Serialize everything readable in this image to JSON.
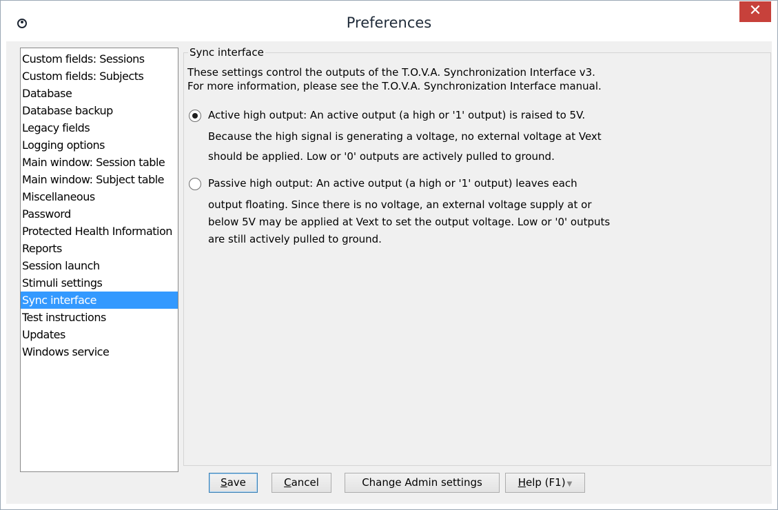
{
  "window": {
    "title": "Preferences",
    "close_glyph": "✕"
  },
  "sidebar": {
    "items": [
      {
        "label": "Custom fields: Sessions"
      },
      {
        "label": "Custom fields: Subjects"
      },
      {
        "label": "Database"
      },
      {
        "label": "Database backup"
      },
      {
        "label": "Legacy fields"
      },
      {
        "label": "Logging options"
      },
      {
        "label": "Main window: Session table"
      },
      {
        "label": "Main window: Subject table"
      },
      {
        "label": "Miscellaneous"
      },
      {
        "label": "Password"
      },
      {
        "label": "Protected Health Information"
      },
      {
        "label": "Reports"
      },
      {
        "label": "Session launch"
      },
      {
        "label": "Stimuli settings"
      },
      {
        "label": "Sync interface",
        "selected": true
      },
      {
        "label": "Test instructions"
      },
      {
        "label": "Updates"
      },
      {
        "label": "Windows service"
      }
    ],
    "selected_color": "#3399ff"
  },
  "panel": {
    "legend": "Sync interface",
    "intro_line1": "These settings control the outputs of the T.O.V.A. Synchronization Interface v3.",
    "intro_line2": "For more information, please see the T.O.V.A. Synchronization Interface manual.",
    "options": [
      {
        "checked": true,
        "lines": [
          "Active high output: An active output (a high or '1' output) is raised to 5V.",
          "Because the high signal is generating a voltage, no external voltage at Vext",
          "should be applied. Low or '0' outputs are actively pulled to ground."
        ]
      },
      {
        "checked": false,
        "lines": [
          "Passive high output: An active output (a high or '1' output) leaves each",
          "output floating. Since there is no voltage, an external voltage supply at or",
          "below 5V may be applied at Vext to set the output voltage. Low or '0' outputs",
          "are still actively pulled to ground."
        ]
      }
    ]
  },
  "buttons": {
    "save_prefix": "S",
    "save_rest": "ave",
    "cancel_prefix": "C",
    "cancel_rest": "ancel",
    "admin_pre": "Chan",
    "admin_u": "g",
    "admin_post": "e Admin settings",
    "help_u": "H",
    "help_rest": "elp (F1)",
    "help_arrow": "▼"
  }
}
